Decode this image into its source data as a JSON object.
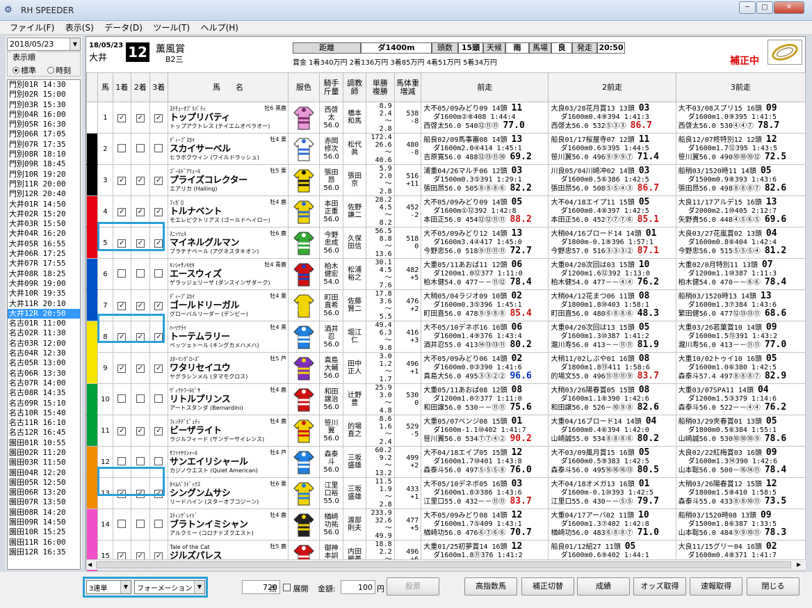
{
  "app": {
    "title": "RH SPEEDER"
  },
  "menu": [
    "ファイル(F)",
    "表示(S)",
    "データ(D)",
    "ツール(T)",
    "ヘルプ(H)"
  ],
  "left": {
    "date": "2018/05/23",
    "order_label": "表示順",
    "radio_std": "標準",
    "radio_time": "時刻",
    "races": [
      "門別01R 14:30",
      "門別02R 15:00",
      "門別03R 15:30",
      "門別04R 16:00",
      "門別05R 16:30",
      "門別06R 17:05",
      "門別07R 17:35",
      "門別08R 18:10",
      "門別09R 18:45",
      "門別10R 19:20",
      "門別11R 20:00",
      "門別12R 20:40",
      "大井01R 14:50",
      "大井02R 15:20",
      "大井03R 15:50",
      "大井04R 16:20",
      "大井05R 16:55",
      "大井06R 17:25",
      "大井07R 17:55",
      "大井08R 18:25",
      "大井09R 19:00",
      "大井10R 19:35",
      "大井11R 20:10",
      "大井12R 20:50",
      "名古01R 11:00",
      "名古02R 11:30",
      "名古03R 12:00",
      "名古04R 12:30",
      "名古05R 13:00",
      "名古06R 13:30",
      "名古07R 14:00",
      "名古08R 14:35",
      "名古09R 15:10",
      "名古10R 15:40",
      "名古11R 16:10",
      "名古12R 16:45",
      "園田01R 10:55",
      "園田02R 11:20",
      "園田03R 11:50",
      "園田04R 12:20",
      "園田05R 12:50",
      "園田06R 13:20",
      "園田07R 13:50",
      "園田08R 14:20",
      "園田09R 14:50",
      "園田10R 15:25",
      "園田11R 16:00",
      "園田12R 16:35"
    ],
    "selected": 23
  },
  "race": {
    "date": "18/05/23",
    "course": "大井",
    "num": "12",
    "name": "薫風賞",
    "class": "B2三",
    "kyori_lbl": "距離",
    "kyori": "ダ1400m",
    "tosu_lbl": "頭数",
    "tosu": "15頭",
    "tenko_lbl": "天候",
    "tenko": "雨",
    "baba_lbl": "馬場",
    "baba": "良",
    "hassou_lbl": "発走",
    "hassou": "20:50",
    "prize": "賞金 1着340万円 2着136万円 3着85万円 4着51万円 5着34万円",
    "hosei": "補正中"
  },
  "headers": {
    "uma": "馬",
    "c1": "1着",
    "c2": "2着",
    "c3": "3着",
    "name": "馬　　名",
    "silk": "服色",
    "jockey": "騎手\n斤量",
    "trainer": "調教\n師",
    "odds": "単勝\n複勝",
    "weight": "馬体重\n増減",
    "p1": "前走",
    "p2": "2前走",
    "p3": "3前走"
  },
  "horses": [
    {
      "n": "1",
      "c": [
        1,
        1,
        1
      ],
      "sire": "ｽﾃﾁｭｰｵﾌﾞﾘﾊﾞﾃｨ",
      "sex": "牡6 黒鹿",
      "name": "トップリバティ",
      "dam": "トップアクトレス (テイエムオペラオー)",
      "j1": "西啓",
      "j2": "太",
      "jw": "56.0",
      "t1": "橋本",
      "t2": "和馬",
      "o1": "8.9",
      "o2": "2.4",
      "o3": "～　2.8",
      "w1": "538",
      "w2": "-8",
      "p1": [
        "大不05/09みどり09 14頭 ",
        "11",
        "ダ1600m②⑧408 1:44:4",
        "西啓太56.0 540⑫⑪⑪ ",
        "77.0",
        ""
      ],
      "p2": [
        "大良03/28花月賞13 13頭 ",
        "03",
        "ダ1600m0.4⑨394 1:41:3",
        "西啓太56.0 532⑤③③ ",
        "86.7",
        "red"
      ],
      "p3": [
        "大不03/08スプリ15 16頭 ",
        "09",
        "ダ1600m1.0⑨395 1:41:5",
        "西啓太56.0 530④④⑦ ",
        "78.7",
        ""
      ]
    },
    {
      "n": "2",
      "c": [
        0,
        0,
        0
      ],
      "sire": "ﾃﾞｨｰﾌﾟｽｶｲ",
      "sex": "牡4 栗",
      "name": "スカイサーベル",
      "dam": "ヒラボクウィン (ワイルドラッシュ)",
      "j1": "赤岡",
      "j2": "修次",
      "jw": "56.0",
      "t1": "松代",
      "t2": "眞",
      "o1": "172.4",
      "o2": "26.6",
      "o3": "～　40.6",
      "w1": "480",
      "w2": "-8",
      "p1": [
        "船良02/09馬事審08 14頭 ",
        "13",
        "ダ1600m2.0④414 1:45:1",
        "吉原寛56.0 488⑫⑬⑪⑩ ",
        "69.2",
        ""
      ],
      "p2": [
        "船良01/17桜屋寺07 12頭 ",
        "11",
        "ダ1600m0.6⑤395 1:44:5",
        "笹川翼56.0 496⑨⑨⑨⑦ ",
        "71.4",
        ""
      ],
      "p3": [
        "船良12/07柊特別12 12頭 ",
        "12",
        "ダ1600m1.7⑫395 1:43:5",
        "笹川翼56.0 490⑩⑩⑩⑫ ",
        "72.5",
        ""
      ]
    },
    {
      "n": "3",
      "c": [
        1,
        1,
        1
      ],
      "sire": "ｺﾞｰﾙﾄﾞｱﾘｭｰﾙ",
      "sex": "牡5 栗",
      "name": "プライズコレクター",
      "dam": "エアリカ (Halling)",
      "j1": "張田",
      "j2": "昂",
      "jw": "56.0",
      "t1": "張田",
      "t2": "京",
      "o1": "5.9",
      "o2": "2.0",
      "o3": "～　2.8",
      "w1": "516",
      "w2": "+11",
      "p1": [
        "浦重04/26マルチ06 12頭 ",
        "03",
        "ダ1500m0.3⑤391 1:29:1",
        "張田昂56.0 505⑧⑧⑧⑥ ",
        "82.2",
        ""
      ],
      "p2": [
        "川良05/04川崎冲02 14頭 ",
        "03",
        "ダ1600m0.5⑥386 1:42:5",
        "張田昂56.0 508⑤⑤④③ ",
        "86.7",
        "red"
      ],
      "p3": [
        "船稍03/1520時11 14頭 ",
        "05",
        "ダ1500m0.9⑧393 1:43:6",
        "張田昂56.0 498⑧⑧⑧⑦ ",
        "82.6",
        ""
      ]
    },
    {
      "n": "4",
      "c": [
        1,
        1,
        1
      ],
      "sire": "ﾌｨｶﾞﾛ",
      "sex": "牡4 鹿",
      "name": "トルナベント",
      "dam": "モエレビクトリアス (ゴールドヘイロー)",
      "j1": "本田",
      "j2": "正重",
      "jw": "56.0",
      "t1": "佐野",
      "t2": "謙二",
      "o1": "28.2",
      "o2": "4.5",
      "o3": "～　8.2",
      "w1": "452",
      "w2": "-2",
      "p1": [
        "大不05/09みどり09 14頭 ",
        "05",
        "ダ1600m①⑫392 1:42:8",
        "本田正56.0 454⑫⑫⑪⑪ ",
        "88.2",
        "red"
      ],
      "p2": [
        "大不04/18エイプ11 15頭 ",
        "05",
        "ダ1600m0.4⑧397 1:42:5",
        "本田正56.0 452⑦⑦⑦⑥ ",
        "85.1",
        "red"
      ],
      "p3": [
        "大良11/17アルデ15 16頭 ",
        "13",
        "ダ2000m2.1⑩405 2:12:7",
        "矢野貴56.0 448④⑤⑥⑤ ",
        "69.6",
        ""
      ]
    },
    {
      "n": "5",
      "c": [
        1,
        1,
        1
      ],
      "sire": "ｽﾆｯﾂｪﾙ",
      "sex": "牡6 鹿",
      "name": "マイネルグルマン",
      "dam": "プラチナペール (アグネスタキオン)",
      "j1": "今野",
      "j2": "忠成",
      "jw": "56.0",
      "t1": "久保",
      "t2": "田信",
      "o1": "56.5",
      "o2": "8.8",
      "o3": "～　13.6",
      "w1": "518",
      "w2": "0",
      "p1": [
        "大不05/09みどり12 14頭 ",
        "13",
        "ダ1600m3.4④417 1:45:0",
        "今野忠56.0 518⑨⑪⑪⑪ ",
        "72.7",
        ""
      ],
      "p2": [
        "大稍04/16ブロード14 14頭 ",
        "01",
        "ダ1800m-0.1⑧396 1:57:1",
        "今野忠57.0 516③③③② ",
        "87.1",
        "red"
      ],
      "p3": [
        "大良03/27花嵐賞02 13頭 ",
        "04",
        "ダ1600m0.8⑥404 1:42:4",
        "今野忠56.0 515⑤⑤⑤④ ",
        "81.2",
        ""
      ]
    },
    {
      "n": "6",
      "c": [
        0,
        0,
        0
      ],
      "sire": "ｷﾝｼｬｻﾉｷｾｷ",
      "sex": "牡4 青鹿",
      "name": "エースウィズ",
      "dam": "ゲラッジェリーザ (ダンスインザダーク)",
      "j1": "柏木",
      "j2": "健宏",
      "jw": "54.0",
      "t1": "松浦",
      "t2": "裕之",
      "o1": "30.1",
      "o2": "4.5",
      "o3": "～　7.6",
      "w1": "482",
      "w2": "+5",
      "p1": [
        "大重05/11あおば11 12頭 ",
        "06",
        "ダ1200m1.0⑫377 1:11:0",
        "柏木健54.0 477－－⑪⑫ ",
        "78.4",
        ""
      ],
      "p2": [
        "大重04/20次回は03 15頭 ",
        "10",
        "ダ1200m1.6⑫392 1:13:0",
        "柏木健54.0 477－－④④ ",
        "76.2",
        ""
      ],
      "p3": [
        "大重02/0月特別11 13頭 ",
        "07",
        "ダ1200m1.1⑩387 1:11:3",
        "柏木健54.0 470－－⑥⑥ ",
        "78.4",
        ""
      ]
    },
    {
      "n": "7",
      "c": [
        1,
        1,
        1
      ],
      "sire": "ﾃﾞｨｰﾌﾟｽｶｲ",
      "sex": "牡4 栗",
      "name": "ゴールドリーガル",
      "dam": "グローバルリーダー (デンビー)",
      "j1": "町田",
      "j2": "直希",
      "jw": "56.0",
      "t1": "佐藤",
      "t2": "賢二",
      "o1": "17.8",
      "o2": "3.6",
      "o3": "～　5.5",
      "w1": "476",
      "w2": "+2",
      "p1": [
        "大稍05/04ラジオ09 10頭 ",
        "02",
        "ダ1600m0.3⑤396 1:45:1",
        "町田直56.0 478⑨⑨⑧⑧ ",
        "85.4",
        "red"
      ],
      "p2": [
        "大稍04/12花まつ06 11頭 ",
        "08",
        "ダ1800m1.8⑩403 1:58:1",
        "町田直56.0 480⑥⑧⑧⑥ ",
        "48.3",
        ""
      ],
      "p3": [
        "船稍03/1520時13 14頭 ",
        "13",
        "ダ1600m1.3⑦384 1:43:6",
        "繁田健56.0 477⑫⑬⑬⑪ ",
        "68.6",
        ""
      ]
    },
    {
      "n": "8",
      "c": [
        1,
        1,
        1
      ],
      "sire": "ﾊｰﾂｸﾗｲ",
      "sex": "牡4 黒",
      "name": "トーテムラリー",
      "dam": "ペッツェトール (キングカメハメハ)",
      "j1": "酒井",
      "j2": "忍",
      "jw": "56.0",
      "t1": "堀江",
      "t2": "仁",
      "o1": "49.4",
      "o2": "6.3",
      "o3": "～　9.8",
      "w1": "416",
      "w2": "+3",
      "p1": [
        "大不05/10デネボ16 16頭 ",
        "06",
        "ダ1600m1.4⑨376 1:43:4",
        "酒井忍55.0 413⑭⑬⑬⑪ ",
        "80.2",
        ""
      ],
      "p2": [
        "大重04/20次回は13 15頭 ",
        "05",
        "ダ1600m1.3⑩387 1:41:2",
        "瀧川寿56.0 413－－⑪⑪ ",
        "81.9",
        ""
      ],
      "p3": [
        "大重03/26若葉賞10 14頭 ",
        "09",
        "ダ1600m1.5⑬391 1:43:2",
        "瀧川寿56.0 413－－⑪⑪ ",
        "77.0",
        ""
      ]
    },
    {
      "n": "9",
      "c": [
        1,
        1,
        1
      ],
      "sire": "ｽﾀｰﾘﾝｸﾞﾛｰｽﾞ",
      "sex": "牡5 芦",
      "name": "ワタリセイユウ",
      "dam": "ヤグラシンメル (タマモクロス)",
      "j1": "真島",
      "j2": "大輔",
      "jw": "56.0",
      "t1": "田中",
      "t2": "正人",
      "o1": "3.0",
      "o2": "1.2",
      "o3": "～　1.7",
      "w1": "496",
      "w2": "+1",
      "p1": [
        "大不05/09みどり06 14頭 ",
        "02",
        "ダ1600m0.0③390 1:41:6",
        "真島大56.0 495③③②② ",
        "96.6",
        "blue"
      ],
      "p2": [
        "大稍11/02しぶや01 16頭 ",
        "08",
        "ダ1800m1.8⑬411 1:58:6",
        "的場文55.0 496⑪⑪⑪⑨ ",
        "83.7",
        "red"
      ],
      "p3": [
        "大重10/02トゥイ10 16頭 ",
        "05",
        "ダ1600m1.0⑥380 1:42:5",
        "森泰斗57.4 497⑧⑧⑧⑦ ",
        "82.9",
        ""
      ]
    },
    {
      "n": "10",
      "c": [
        0,
        0,
        0
      ],
      "sire": "ｳﾞｨｸﾄﾜｰﾙﾋﾟｻ",
      "sex": "牡4 鹿",
      "name": "リトルプリンス",
      "dam": "アートスタンダ (Bernardini)",
      "j1": "和田",
      "j2": "譲治",
      "jw": "56.0",
      "t1": "辻野",
      "t2": "豊",
      "o1": "25.9",
      "o2": "3.0",
      "o3": "～　4.8",
      "w1": "530",
      "w2": "0",
      "p1": [
        "大重05/11あおば08 12頭 ",
        "08",
        "ダ1200m1.0⑦377 1:11:0",
        "和田譲56.0 530－－⑪⑪ ",
        "75.6",
        ""
      ],
      "p2": [
        "大稍03/26陽春賞05 15頭 ",
        "08",
        "ダ1600m1.1⑧390 1:42:6",
        "和田譲56.0 526－⑩⑨⑧ ",
        "82.6",
        ""
      ],
      "p3": [
        "大重03/07SPA11 14頭 ",
        "04",
        "ダ1200m1.5③379 1:14:6",
        "森泰斗56.0 522－－④④ ",
        "76.2",
        ""
      ]
    },
    {
      "n": "11",
      "c": [
        1,
        1,
        1
      ],
      "sire": "ﾌﾚﾝﾁﾃﾞﾋﾟｭﾃｨ",
      "sex": "牡4 鹿",
      "name": "ビーザライト",
      "dam": "ラジルフィード (サンデーサイレンス)",
      "j1": "笹川",
      "j2": "翼",
      "jw": "56.0",
      "t1": "的場",
      "t2": "直之",
      "o1": "8.6",
      "o2": "1.6",
      "o3": "～　2.4",
      "w1": "529",
      "w2": "-5",
      "p1": [
        "大重05/07ベンジ08 15頭 ",
        "01",
        "ダ1600m-1.1⑩402 1:41:7",
        "笹川翼56.0 534⑦⑦④② ",
        "90.2",
        "red"
      ],
      "p2": [
        "大重04/16ブロード14 14頭 ",
        "04",
        "ダ1600m0.4⑥394 1:42:0",
        "山崎誠55.0 534⑧⑧⑧⑥ ",
        "80.2",
        ""
      ],
      "p3": [
        "船稍03/29夾春賞01 13頭 ",
        "05",
        "ダ1800m0.5⑥384 1:55:1",
        "山崎誠56.0 530⑩⑩⑩⑨ ",
        "78.6",
        ""
      ]
    },
    {
      "n": "12",
      "c": [
        0,
        0,
        0
      ],
      "sire": "ｻﾌｧｲﾔﾘｼｬｰﾙ",
      "sex": "牡4 芦",
      "name": "サンエイリシャール",
      "dam": "カジノウエスト (Quiet American)",
      "j1": "森泰",
      "j2": "斗",
      "jw": "56.0",
      "t1": "三坂",
      "t2": "盛雄",
      "o1": "60.2",
      "o2": "9.2",
      "o3": "～　13.2",
      "w1": "499",
      "w2": "+2",
      "p1": [
        "大不04/18エイプ05 15頭 ",
        "12",
        "ダ1600m1.7⑩401 1:43:8",
        "森泰斗56.0 497⑤⑤⑤⑧ ",
        "76.0",
        ""
      ],
      "p2": [
        "大不03/09風月賞15 16頭 ",
        "05",
        "ダ1600m0.5⑨383 1:42:5",
        "森泰斗56.0 495⑯⑯⑯⑬ ",
        "80.5",
        ""
      ],
      "p3": [
        "大良02/22紅梅賞03 16頭 ",
        "09",
        "ダ1600m1.3⑭390 1:42:6",
        "山本聡56.0 500－⑯⑭⑪ ",
        "78.4",
        ""
      ]
    },
    {
      "n": "13",
      "c": [
        1,
        1,
        1
      ],
      "sire": "ﾀｲﾑﾊﾟﾗﾄﾞｯｸｽ",
      "sex": "牡6 栗",
      "name": "シングンムサシ",
      "dam": "リードハイン (スターオブコジーン)",
      "j1": "江里",
      "j2": "口裕",
      "jw": "55.0",
      "t1": "三坂",
      "t2": "盛雄",
      "o1": "11.5",
      "o2": "1.9",
      "o3": "～　2.8",
      "w1": "433",
      "w2": "+1",
      "p1": [
        "大不05/10デネボ05 16頭 ",
        "03",
        "ダ1600m1.8③386 1:43:6",
        "江里口55.0 432－－⑪⑪ ",
        "83.7",
        "red"
      ],
      "p2": [
        "大不04/18オメガ13 16頭 ",
        "01",
        "ダ1600m-0.1⑩393 1:42:5",
        "江里口55.0 430－－⑤⑤ ",
        "79.7",
        ""
      ],
      "p3": [
        "大稍03/26陽春賞12 15頭 ",
        "12",
        "ダ1800m1.5⑧410 1:58:5",
        "森泰斗55.0 433⑧⑧⑩⑪ ",
        "73.5",
        ""
      ]
    },
    {
      "n": "14",
      "c": [
        0,
        0,
        0
      ],
      "sire": "ｽﾃｨﾝｸﾞﾚｲﾄﾞ",
      "sex": "牡4 鹿",
      "name": "ブラトンイミシャン",
      "dam": "アルクミー (コロナドズクエスト)",
      "j1": "楢崎",
      "j2": "功祐",
      "jw": "56.0",
      "t1": "渡部",
      "t2": "則夫",
      "o1": "233.9",
      "o2": "32.6",
      "o3": "～　49.9",
      "w1": "477",
      "w2": "+5",
      "p1": [
        "大不05/09みどり08 14頭 ",
        "12",
        "ダ1600m1.7⑤409 1:43:1",
        "楢崎功56.0 476⑥⑦⑥⑥ ",
        "70.7",
        ""
      ],
      "p2": [
        "大重04/17アーバ02 11頭 ",
        "10",
        "ダ1600m1.3⑦402 1:42:8",
        "楢崎功56.0 483⑥⑧⑧⑦ ",
        "71.0",
        ""
      ],
      "p3": [
        "船稍03/1520時08 13頭 ",
        "09",
        "ダ1500m1.8⑥387 1:33:5",
        "山本聡56.0 484⑨⑨⑩⑪ ",
        "78.3",
        ""
      ]
    },
    {
      "n": "15",
      "c": [
        1,
        1,
        1
      ],
      "sire": "Tale of the Cat",
      "sex": "牡5 鹿",
      "name": "ジルズパレス",
      "dam": "Jill's Gem (Mineshaft)",
      "j1": "御神",
      "j2": "本訓",
      "jw": "56.0",
      "t1": "内田",
      "t2": "勝義",
      "o1": "18.8",
      "o2": "2.2",
      "o3": "～　3.1",
      "w1": "496",
      "w2": "+6",
      "p1": [
        "大重01/25初夢賞14 16頭 ",
        "12",
        "ダ1600m1.8⑪376 1:41:2",
        "吉原寛54.0 490－－⑪⑩ ",
        "74.9",
        ""
      ],
      "p2": [
        "船良01/12紹27 11頭 ",
        "05",
        "ダ1600m0.6⑨402 1:44:1",
        "笹川翼56.0 492－－⑦⑧ ",
        "78.1",
        ""
      ],
      "p3": [
        "大良11/15グリー04 16頭 ",
        "02",
        "ダ1600m0.4⑧371 1:41:7",
        "矢野貴54.0 488－－④④ ",
        "84.7",
        "red"
      ]
    }
  ],
  "footer": {
    "bet_type": "3連単",
    "mode": "フォーメーション",
    "points": "720",
    "points_unit": "点",
    "tenkai": "展開",
    "kingaku_lbl": "金額:",
    "kingaku": "100",
    "yen": "円",
    "buy": "投票",
    "b1": "高指数馬",
    "b2": "補正切替",
    "b3": "成績",
    "b4": "オッズ取得",
    "b5": "速報取得",
    "b6": "閉じる"
  },
  "colors": {
    "accent": "#2a9fd8",
    "selected": "#3399ff",
    "waku": [
      "#ffffff",
      "#000000",
      "#e60012",
      "#0050c8",
      "#f5e400",
      "#00a03c",
      "#f08c00",
      "#f050c8"
    ]
  }
}
